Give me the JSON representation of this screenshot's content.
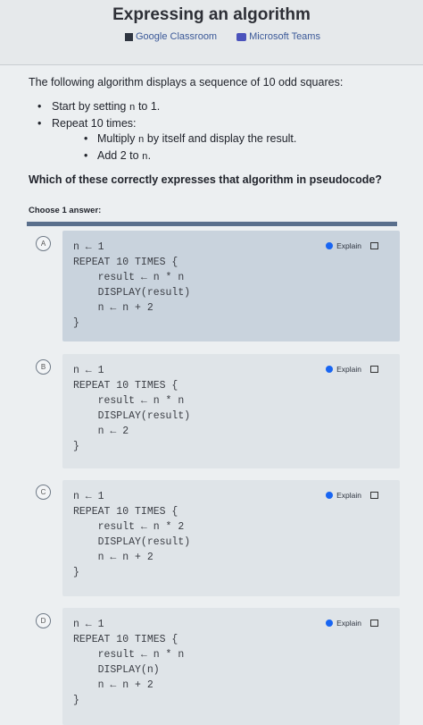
{
  "header": {
    "title": "Expressing an algorithm",
    "google_classroom": "Google Classroom",
    "microsoft_teams": "Microsoft Teams"
  },
  "question": {
    "intro": "The following algorithm displays a sequence of 10 odd squares:",
    "step1_prefix": "Start by setting ",
    "step1_var": "n",
    "step1_suffix": " to 1.",
    "step2": "Repeat 10 times:",
    "sub1_prefix": "Multiply ",
    "sub1_var": "n",
    "sub1_suffix": " by itself and display the result.",
    "sub2_prefix": "Add 2 to ",
    "sub2_var": "n",
    "sub2_suffix": ".",
    "prompt": "Which of these correctly expresses that algorithm in pseudocode?",
    "choose": "Choose 1 answer:"
  },
  "options": [
    {
      "letter": "A",
      "explain": "Explain",
      "code": "n ← 1\nREPEAT 10 TIMES {\n    result ← n * n\n    DISPLAY(result)\n    n ← n + 2\n}"
    },
    {
      "letter": "B",
      "explain": "Explain",
      "code": "n ← 1\nREPEAT 10 TIMES {\n    result ← n * n\n    DISPLAY(result)\n    n ← 2\n}"
    },
    {
      "letter": "C",
      "explain": "Explain",
      "code": "n ← 1\nREPEAT 10 TIMES {\n    result ← n * 2\n    DISPLAY(result)\n    n ← n + 2\n}"
    },
    {
      "letter": "D",
      "explain": "Explain",
      "code": "n ← 1\nREPEAT 10 TIMES {\n    result ← n * n\n    DISPLAY(n)\n    n ← n + 2\n}"
    }
  ]
}
